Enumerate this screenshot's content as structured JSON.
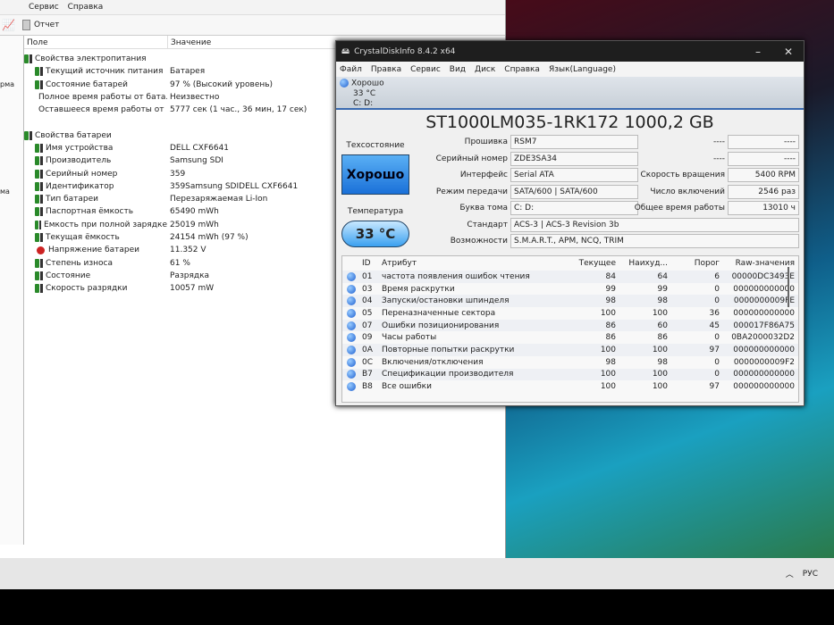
{
  "aida": {
    "menu": [
      "Сервис",
      "Справка"
    ],
    "toolbar": {
      "report": "Отчет"
    },
    "tree_fragments": [
      "рма",
      "ма"
    ],
    "columns": {
      "field": "Поле",
      "value": "Значение"
    },
    "groups": [
      {
        "title": "Свойства электропитания",
        "rows": [
          {
            "f": "Текущий источник питания",
            "v": "Батарея"
          },
          {
            "f": "Состояние батарей",
            "v": "97 % (Высокий уровень)"
          },
          {
            "f": "Полное время работы от бата...",
            "v": "Неизвестно"
          },
          {
            "f": "Оставшееся время работы от ...",
            "v": "5777 сек (1 час., 36 мин, 17 сек)"
          }
        ]
      },
      {
        "title": "Свойства батареи",
        "rows": [
          {
            "f": "Имя устройства",
            "v": "DELL CXF6641"
          },
          {
            "f": "Производитель",
            "v": "Samsung SDI"
          },
          {
            "f": "Серийный номер",
            "v": "359"
          },
          {
            "f": "Идентификатор",
            "v": "359Samsung SDIDELL CXF6641"
          },
          {
            "f": "Тип батареи",
            "v": "Перезаряжаемая Li-Ion"
          },
          {
            "f": "Паспортная ёмкость",
            "v": "65490 mWh"
          },
          {
            "f": "Емкость при полной зарядке",
            "v": "25019 mWh"
          },
          {
            "f": "Текущая ёмкость",
            "v": "24154 mWh  (97 %)"
          },
          {
            "f": "Напряжение батареи",
            "v": "11.352 V"
          },
          {
            "f": "Степень износа",
            "v": "61 %"
          },
          {
            "f": "Состояние",
            "v": "Разрядка"
          },
          {
            "f": "Скорость разрядки",
            "v": "10057 mW"
          }
        ]
      }
    ]
  },
  "cdi": {
    "title": "CrystalDiskInfo 8.4.2 x64",
    "menu": [
      "Файл",
      "Правка",
      "Сервис",
      "Вид",
      "Диск",
      "Справка",
      "Язык(Language)"
    ],
    "drive_tab": {
      "status": "Хорошо",
      "temp": "33 °C",
      "letters": "C: D:"
    },
    "model": "ST1000LM035-1RK172 1000,2 GB",
    "health_label": "Техсостояние",
    "health": "Хорошо",
    "temp_label": "Температура",
    "temp": "33 °C",
    "fields": [
      {
        "l": "Прошивка",
        "v": "RSM7"
      },
      {
        "l": "Серийный номер",
        "v": "ZDE3SA34"
      },
      {
        "l": "Интерфейс",
        "v": "Serial ATA"
      },
      {
        "l": "Режим передачи",
        "v": "SATA/600 | SATA/600"
      },
      {
        "l": "Буква тома",
        "v": "C: D:"
      },
      {
        "l": "Стандарт",
        "v": "ACS-3 | ACS-3 Revision 3b"
      },
      {
        "l": "Возможности",
        "v": "S.M.A.R.T., APM, NCQ, TRIM"
      }
    ],
    "right_fields": [
      {
        "l": "----",
        "v": "----"
      },
      {
        "l": "----",
        "v": "----"
      },
      {
        "l": "Скорость вращения",
        "v": "5400 RPM"
      },
      {
        "l": "Число включений",
        "v": "2546 раз"
      },
      {
        "l": "Общее время работы",
        "v": "13010 ч"
      }
    ],
    "table_header": [
      "ID",
      "Атрибут",
      "Текущее",
      "Наихуд...",
      "Порог",
      "Raw-значения"
    ],
    "rows": [
      [
        "01",
        "частота появления ошибок чтения",
        "84",
        "64",
        "6",
        "00000DC3493E"
      ],
      [
        "03",
        "Время раскрутки",
        "99",
        "99",
        "0",
        "000000000000"
      ],
      [
        "04",
        "Запуски/остановки шпинделя",
        "98",
        "98",
        "0",
        "0000000009FE"
      ],
      [
        "05",
        "Переназначенные сектора",
        "100",
        "100",
        "36",
        "000000000000"
      ],
      [
        "07",
        "Ошибки позиционирования",
        "86",
        "60",
        "45",
        "000017F86A75"
      ],
      [
        "09",
        "Часы работы",
        "86",
        "86",
        "0",
        "0BA2000032D2"
      ],
      [
        "0A",
        "Повторные попытки раскрутки",
        "100",
        "100",
        "97",
        "000000000000"
      ],
      [
        "0C",
        "Включения/отключения",
        "98",
        "98",
        "0",
        "0000000009F2"
      ],
      [
        "B7",
        "Спецификации производителя",
        "100",
        "100",
        "0",
        "000000000000"
      ],
      [
        "B8",
        "Все ошибки",
        "100",
        "100",
        "97",
        "000000000000"
      ]
    ]
  },
  "taskbar": {
    "lang": "РУС"
  }
}
